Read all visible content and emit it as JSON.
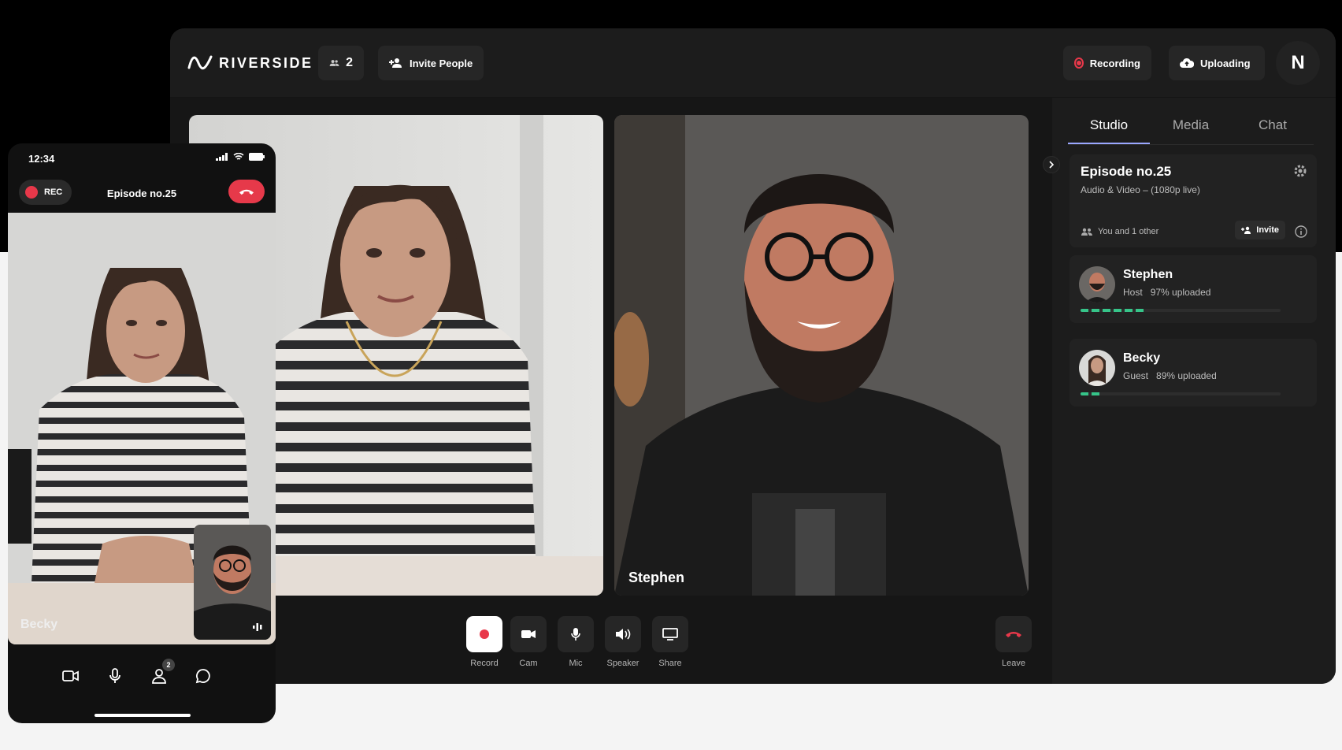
{
  "app": {
    "brand": "RIVERSIDE"
  },
  "header": {
    "participants_count": "2",
    "invite_label": "Invite People",
    "recording_label": "Recording",
    "uploading_label": "Uploading",
    "user_initial": "N"
  },
  "stage": {
    "tiles": [
      {
        "label": ""
      },
      {
        "label": "Stephen"
      }
    ]
  },
  "controls": {
    "record": "Record",
    "cam": "Cam",
    "mic": "Mic",
    "speaker": "Speaker",
    "share": "Share",
    "leave": "Leave"
  },
  "panel": {
    "tabs": [
      "Studio",
      "Media",
      "Chat"
    ],
    "active_tab": "Studio",
    "episode": {
      "title": "Episode no.25",
      "subtitle": "Audio & Video – (1080p live)",
      "people": "You and 1 other",
      "invite": "Invite"
    },
    "participants": [
      {
        "name": "Stephen",
        "role": "Host",
        "upload": "97% uploaded",
        "progress": 0.97
      },
      {
        "name": "Becky",
        "role": "Guest",
        "upload": "89% uploaded",
        "progress": 0.89
      }
    ]
  },
  "phone": {
    "time": "12:34",
    "rec": "REC",
    "title": "Episode no.25",
    "video_label": "Becky",
    "participants_badge": "2"
  },
  "colors": {
    "accent_red": "#e8384a",
    "upload_green": "#36c489",
    "tab_underline": "#9aa7ff"
  }
}
